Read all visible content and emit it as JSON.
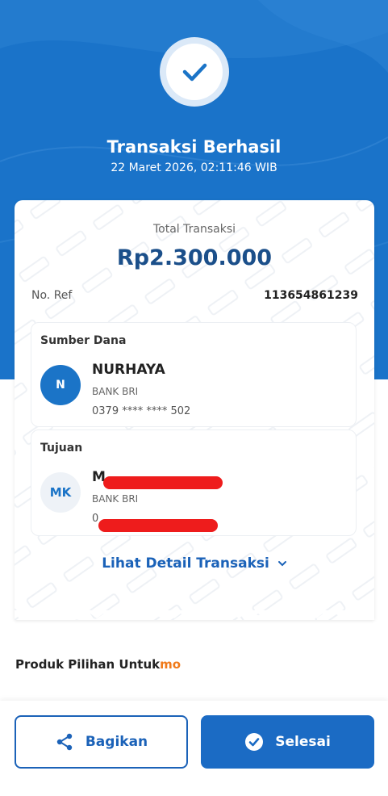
{
  "header": {
    "title": "Transaksi Berhasil",
    "datetime": "22 Maret 2026, 02:11:46 WIB"
  },
  "receipt": {
    "total_label": "Total Transaksi",
    "total_amount": "Rp2.300.000",
    "ref_label": "No. Ref",
    "ref_value": "113654861239",
    "source": {
      "heading": "Sumber Dana",
      "initials": "N",
      "name": "NURHAYA",
      "bank": "BANK BRI",
      "account": "0379 **** **** 502"
    },
    "destination": {
      "heading": "Tujuan",
      "initials": "MK",
      "name_visible": "M",
      "bank": "BANK BRI",
      "account_visible": "0"
    },
    "detail_link": "Lihat Detail Transaksi"
  },
  "products": {
    "title_main": "Produk Pilihan Untuk",
    "title_accent": "mo"
  },
  "actions": {
    "share_label": "Bagikan",
    "done_label": "Selesai"
  },
  "colors": {
    "primary": "#1a73c9",
    "amount": "#1b4f8a",
    "accent": "#f07a1a",
    "redaction": "#ee1c1c"
  }
}
